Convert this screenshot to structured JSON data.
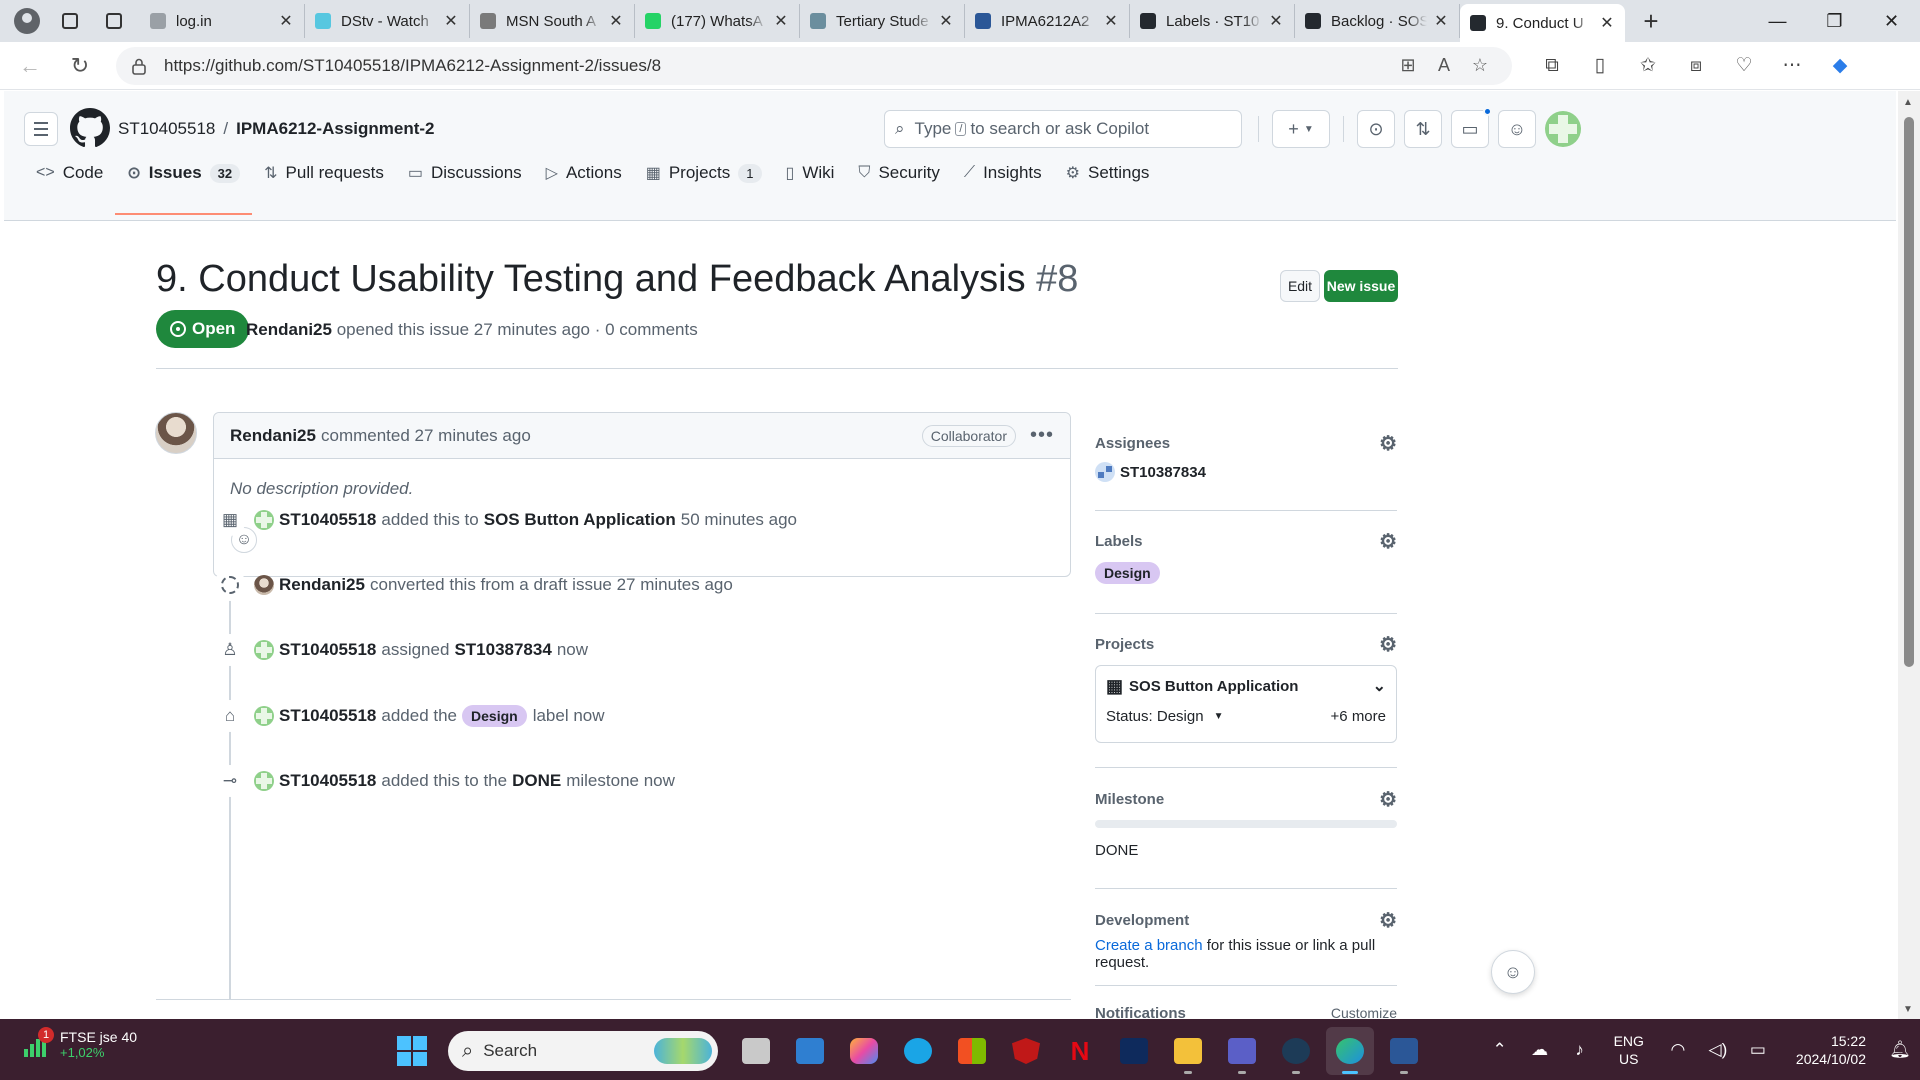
{
  "browser": {
    "tabs": [
      {
        "title": "log.in",
        "favicon_color": "#9aa0a6"
      },
      {
        "title": "DStv - Watch",
        "favicon_color": "#57c7e0"
      },
      {
        "title": "MSN South A",
        "favicon_color": "#7a7a7a"
      },
      {
        "title": "(177) WhatsA",
        "favicon_color": "#25d366"
      },
      {
        "title": "Tertiary Stude",
        "favicon_color": "#6b8e9e"
      },
      {
        "title": "IPMA6212A2",
        "favicon_color": "#2b5797"
      },
      {
        "title": "Labels · ST10",
        "favicon_color": "#24292f"
      },
      {
        "title": "Backlog · SOS",
        "favicon_color": "#24292f"
      },
      {
        "title": "9. Conduct U",
        "favicon_color": "#24292f"
      }
    ],
    "active_tab_index": 8,
    "url": "https://github.com/ST10405518/IPMA6212-Assignment-2/issues/8"
  },
  "header": {
    "owner": "ST10405518",
    "separator": "/",
    "repo": "IPMA6212-Assignment-2",
    "search_placeholder_pre": "Type",
    "search_key": "/",
    "search_placeholder_post": "to search or ask Copilot"
  },
  "repo_nav": [
    {
      "label": "Code",
      "icon": "code-icon",
      "glyph": "<>"
    },
    {
      "label": "Issues",
      "icon": "issue-icon",
      "glyph": "⊙",
      "count": "32",
      "active": true
    },
    {
      "label": "Pull requests",
      "icon": "pull-request-icon",
      "glyph": "⇅"
    },
    {
      "label": "Discussions",
      "icon": "discussion-icon",
      "glyph": "▭"
    },
    {
      "label": "Actions",
      "icon": "play-icon",
      "glyph": "▷"
    },
    {
      "label": "Projects",
      "icon": "table-icon",
      "glyph": "▦",
      "count": "1"
    },
    {
      "label": "Wiki",
      "icon": "book-icon",
      "glyph": "▯"
    },
    {
      "label": "Security",
      "icon": "shield-icon",
      "glyph": "⛉"
    },
    {
      "label": "Insights",
      "icon": "graph-icon",
      "glyph": "⟋"
    },
    {
      "label": "Settings",
      "icon": "gear-icon",
      "glyph": "⚙"
    }
  ],
  "issue": {
    "title": "9. Conduct Usability Testing and Feedback Analysis",
    "number": "#8",
    "edit_label": "Edit",
    "new_issue_label": "New issue",
    "state": "Open",
    "author": "Rendani25",
    "meta": "opened this issue 27 minutes ago · 0 comments"
  },
  "comment": {
    "author": "Rendani25",
    "action": "commented 27 minutes ago",
    "role": "Collaborator",
    "body": "No description provided."
  },
  "timeline": [
    {
      "icon": "table-icon",
      "glyph": "▦",
      "avatar": "green",
      "actor": "ST10405518",
      "text1": "added this to",
      "target": "SOS Button Application",
      "text2": "50 minutes ago"
    },
    {
      "icon": "draft-icon",
      "glyph": "",
      "avatar": "photo",
      "actor": "Rendani25",
      "text1": "converted this from a draft issue 27 minutes ago",
      "target": "",
      "text2": ""
    },
    {
      "icon": "person-icon",
      "glyph": "♙",
      "avatar": "green",
      "actor": "ST10405518",
      "text1": "assigned",
      "target": "ST10387834",
      "text2": "now"
    },
    {
      "icon": "tag-icon",
      "glyph": "⌂",
      "avatar": "green",
      "actor": "ST10405518",
      "text1": "added the",
      "label": "Design",
      "text2": "label now"
    },
    {
      "icon": "milestone-icon",
      "glyph": "⊸",
      "avatar": "green",
      "actor": "ST10405518",
      "text1": "added this to the",
      "target": "DONE",
      "text2": "milestone now"
    }
  ],
  "sidebar": {
    "assignees_title": "Assignees",
    "assignee": "ST10387834",
    "labels_title": "Labels",
    "label": "Design",
    "label_color": "#d8c7f2",
    "projects_title": "Projects",
    "project_name": "SOS Button Application",
    "project_status": "Status: Design",
    "project_more": "+6 more",
    "milestone_title": "Milestone",
    "milestone_name": "DONE",
    "development_title": "Development",
    "development_link": "Create a branch",
    "development_text": "for this issue or link a pull request.",
    "notifications_title": "Notifications",
    "notifications_action": "Customize"
  },
  "taskbar": {
    "ticker_name": "FTSE jse 40",
    "ticker_change": "+1,02%",
    "ticker_badge": "1",
    "search_label": "Search",
    "lang_line1": "ENG",
    "lang_line2": "US",
    "time": "15:22",
    "date": "2024/10/02"
  },
  "colors": {
    "accent_green": "#1f883d",
    "link_blue": "#0969da",
    "active_tab_underline": "#fd8c73",
    "taskbar_bg": "#3b1f2f"
  }
}
